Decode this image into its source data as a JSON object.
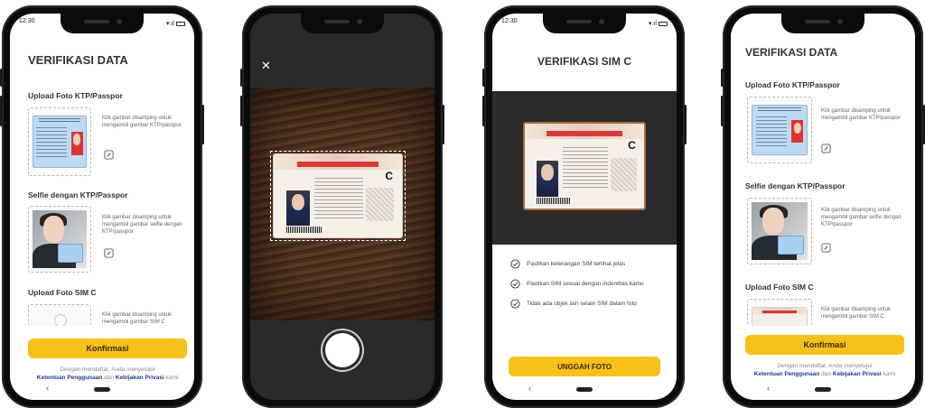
{
  "colors": {
    "accent": "#f6c11b",
    "link": "#1d3c8c",
    "dark_band": "#2a2a2a"
  },
  "screen1": {
    "time": "12:30",
    "title": "VERIFIKASI DATA",
    "sections": [
      {
        "label": "Upload Foto KTP/Passpor",
        "hint": "Klik gambar disamping untuk mengambil gambar KTP/passpor",
        "icon": "edit-icon"
      },
      {
        "label": "Selfie dengan KTP/Passpor",
        "hint": "Klik gambar disamping untuk mengambil gambar selfie dengan KTP/passpor",
        "icon": "edit-icon"
      },
      {
        "label": "Upload Foto SIM C",
        "hint": "Klik gambar disamping untuk mengambil gambar SIM C",
        "icon": "camera-icon"
      }
    ],
    "confirm_label": "Konfirmasi",
    "terms_prefix": "Dengan mendaftar, Anda menyetujui",
    "terms_link1": "Ketentuan Penggunaan",
    "terms_and": "dan",
    "terms_link2": "Kebijakan Privasi",
    "terms_suffix": "kami",
    "nav_back": "‹"
  },
  "screen2": {
    "close_glyph": "✕",
    "card_letter": "C",
    "icons": [
      "close-icon",
      "shutter-button"
    ]
  },
  "screen3": {
    "time": "12:30",
    "title": "VERIFIKASI SIM C",
    "card_letter": "C",
    "checks": [
      "Pastikan keterangan SIM terlihat jelas",
      "Pastikan SIM sesuai dengan indentitas kamu",
      "Tidak ada objek lain selain SIM dalam foto"
    ],
    "button_label": "UNGGAH FOTO",
    "nav_back": "‹"
  },
  "screen4": {
    "title": "VERIFIKASI DATA",
    "sections": [
      {
        "label": "Upload Foto KTP/Passpor",
        "hint": "Klik gambar disamping untuk mengambil gambar KTP/passpor"
      },
      {
        "label": "Selfie dengan KTP/Passpor",
        "hint": "Klik gambar disamping untuk mengambil gambar selfie dengan KTP/passpor"
      },
      {
        "label": "Upload Foto SIM C",
        "hint": "Klik gambar disamping untuk mengambil gambar SIM C"
      }
    ],
    "confirm_label": "Konfirmasi",
    "terms_prefix": "Dengan mendaftar, Anda menyetujui",
    "terms_link1": "Ketentuan Penggunaan",
    "terms_and": "dan",
    "terms_link2": "Kebijakan Privasi",
    "terms_suffix": "kami",
    "nav_back": "‹"
  }
}
